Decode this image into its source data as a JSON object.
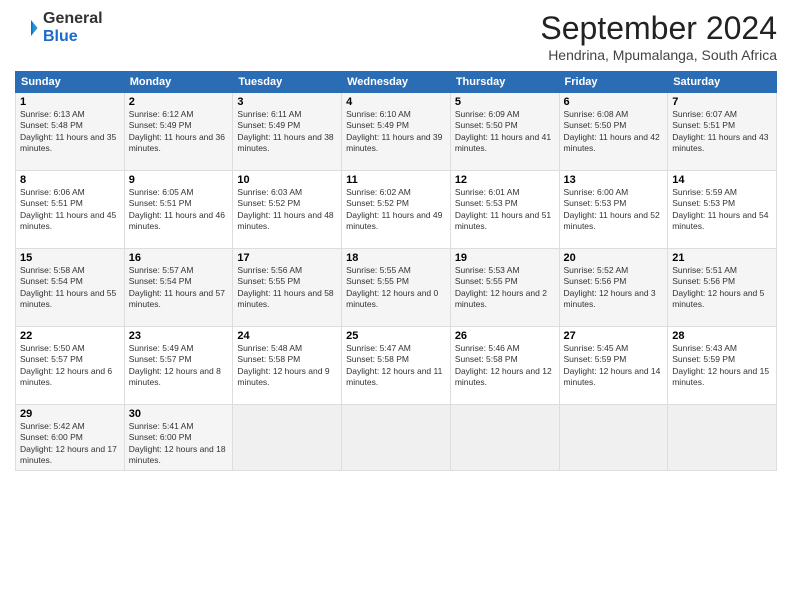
{
  "logo": {
    "general": "General",
    "blue": "Blue"
  },
  "header": {
    "month": "September 2024",
    "location": "Hendrina, Mpumalanga, South Africa"
  },
  "days": [
    "Sunday",
    "Monday",
    "Tuesday",
    "Wednesday",
    "Thursday",
    "Friday",
    "Saturday"
  ],
  "weeks": [
    [
      {
        "day": "1",
        "sunrise": "6:13 AM",
        "sunset": "5:48 PM",
        "daylight": "11 hours and 35 minutes."
      },
      {
        "day": "2",
        "sunrise": "6:12 AM",
        "sunset": "5:49 PM",
        "daylight": "11 hours and 36 minutes."
      },
      {
        "day": "3",
        "sunrise": "6:11 AM",
        "sunset": "5:49 PM",
        "daylight": "11 hours and 38 minutes."
      },
      {
        "day": "4",
        "sunrise": "6:10 AM",
        "sunset": "5:49 PM",
        "daylight": "11 hours and 39 minutes."
      },
      {
        "day": "5",
        "sunrise": "6:09 AM",
        "sunset": "5:50 PM",
        "daylight": "11 hours and 41 minutes."
      },
      {
        "day": "6",
        "sunrise": "6:08 AM",
        "sunset": "5:50 PM",
        "daylight": "11 hours and 42 minutes."
      },
      {
        "day": "7",
        "sunrise": "6:07 AM",
        "sunset": "5:51 PM",
        "daylight": "11 hours and 43 minutes."
      }
    ],
    [
      {
        "day": "8",
        "sunrise": "6:06 AM",
        "sunset": "5:51 PM",
        "daylight": "11 hours and 45 minutes."
      },
      {
        "day": "9",
        "sunrise": "6:05 AM",
        "sunset": "5:51 PM",
        "daylight": "11 hours and 46 minutes."
      },
      {
        "day": "10",
        "sunrise": "6:03 AM",
        "sunset": "5:52 PM",
        "daylight": "11 hours and 48 minutes."
      },
      {
        "day": "11",
        "sunrise": "6:02 AM",
        "sunset": "5:52 PM",
        "daylight": "11 hours and 49 minutes."
      },
      {
        "day": "12",
        "sunrise": "6:01 AM",
        "sunset": "5:53 PM",
        "daylight": "11 hours and 51 minutes."
      },
      {
        "day": "13",
        "sunrise": "6:00 AM",
        "sunset": "5:53 PM",
        "daylight": "11 hours and 52 minutes."
      },
      {
        "day": "14",
        "sunrise": "5:59 AM",
        "sunset": "5:53 PM",
        "daylight": "11 hours and 54 minutes."
      }
    ],
    [
      {
        "day": "15",
        "sunrise": "5:58 AM",
        "sunset": "5:54 PM",
        "daylight": "11 hours and 55 minutes."
      },
      {
        "day": "16",
        "sunrise": "5:57 AM",
        "sunset": "5:54 PM",
        "daylight": "11 hours and 57 minutes."
      },
      {
        "day": "17",
        "sunrise": "5:56 AM",
        "sunset": "5:55 PM",
        "daylight": "11 hours and 58 minutes."
      },
      {
        "day": "18",
        "sunrise": "5:55 AM",
        "sunset": "5:55 PM",
        "daylight": "12 hours and 0 minutes."
      },
      {
        "day": "19",
        "sunrise": "5:53 AM",
        "sunset": "5:55 PM",
        "daylight": "12 hours and 2 minutes."
      },
      {
        "day": "20",
        "sunrise": "5:52 AM",
        "sunset": "5:56 PM",
        "daylight": "12 hours and 3 minutes."
      },
      {
        "day": "21",
        "sunrise": "5:51 AM",
        "sunset": "5:56 PM",
        "daylight": "12 hours and 5 minutes."
      }
    ],
    [
      {
        "day": "22",
        "sunrise": "5:50 AM",
        "sunset": "5:57 PM",
        "daylight": "12 hours and 6 minutes."
      },
      {
        "day": "23",
        "sunrise": "5:49 AM",
        "sunset": "5:57 PM",
        "daylight": "12 hours and 8 minutes."
      },
      {
        "day": "24",
        "sunrise": "5:48 AM",
        "sunset": "5:58 PM",
        "daylight": "12 hours and 9 minutes."
      },
      {
        "day": "25",
        "sunrise": "5:47 AM",
        "sunset": "5:58 PM",
        "daylight": "12 hours and 11 minutes."
      },
      {
        "day": "26",
        "sunrise": "5:46 AM",
        "sunset": "5:58 PM",
        "daylight": "12 hours and 12 minutes."
      },
      {
        "day": "27",
        "sunrise": "5:45 AM",
        "sunset": "5:59 PM",
        "daylight": "12 hours and 14 minutes."
      },
      {
        "day": "28",
        "sunrise": "5:43 AM",
        "sunset": "5:59 PM",
        "daylight": "12 hours and 15 minutes."
      }
    ],
    [
      {
        "day": "29",
        "sunrise": "5:42 AM",
        "sunset": "6:00 PM",
        "daylight": "12 hours and 17 minutes."
      },
      {
        "day": "30",
        "sunrise": "5:41 AM",
        "sunset": "6:00 PM",
        "daylight": "12 hours and 18 minutes."
      },
      null,
      null,
      null,
      null,
      null
    ]
  ]
}
